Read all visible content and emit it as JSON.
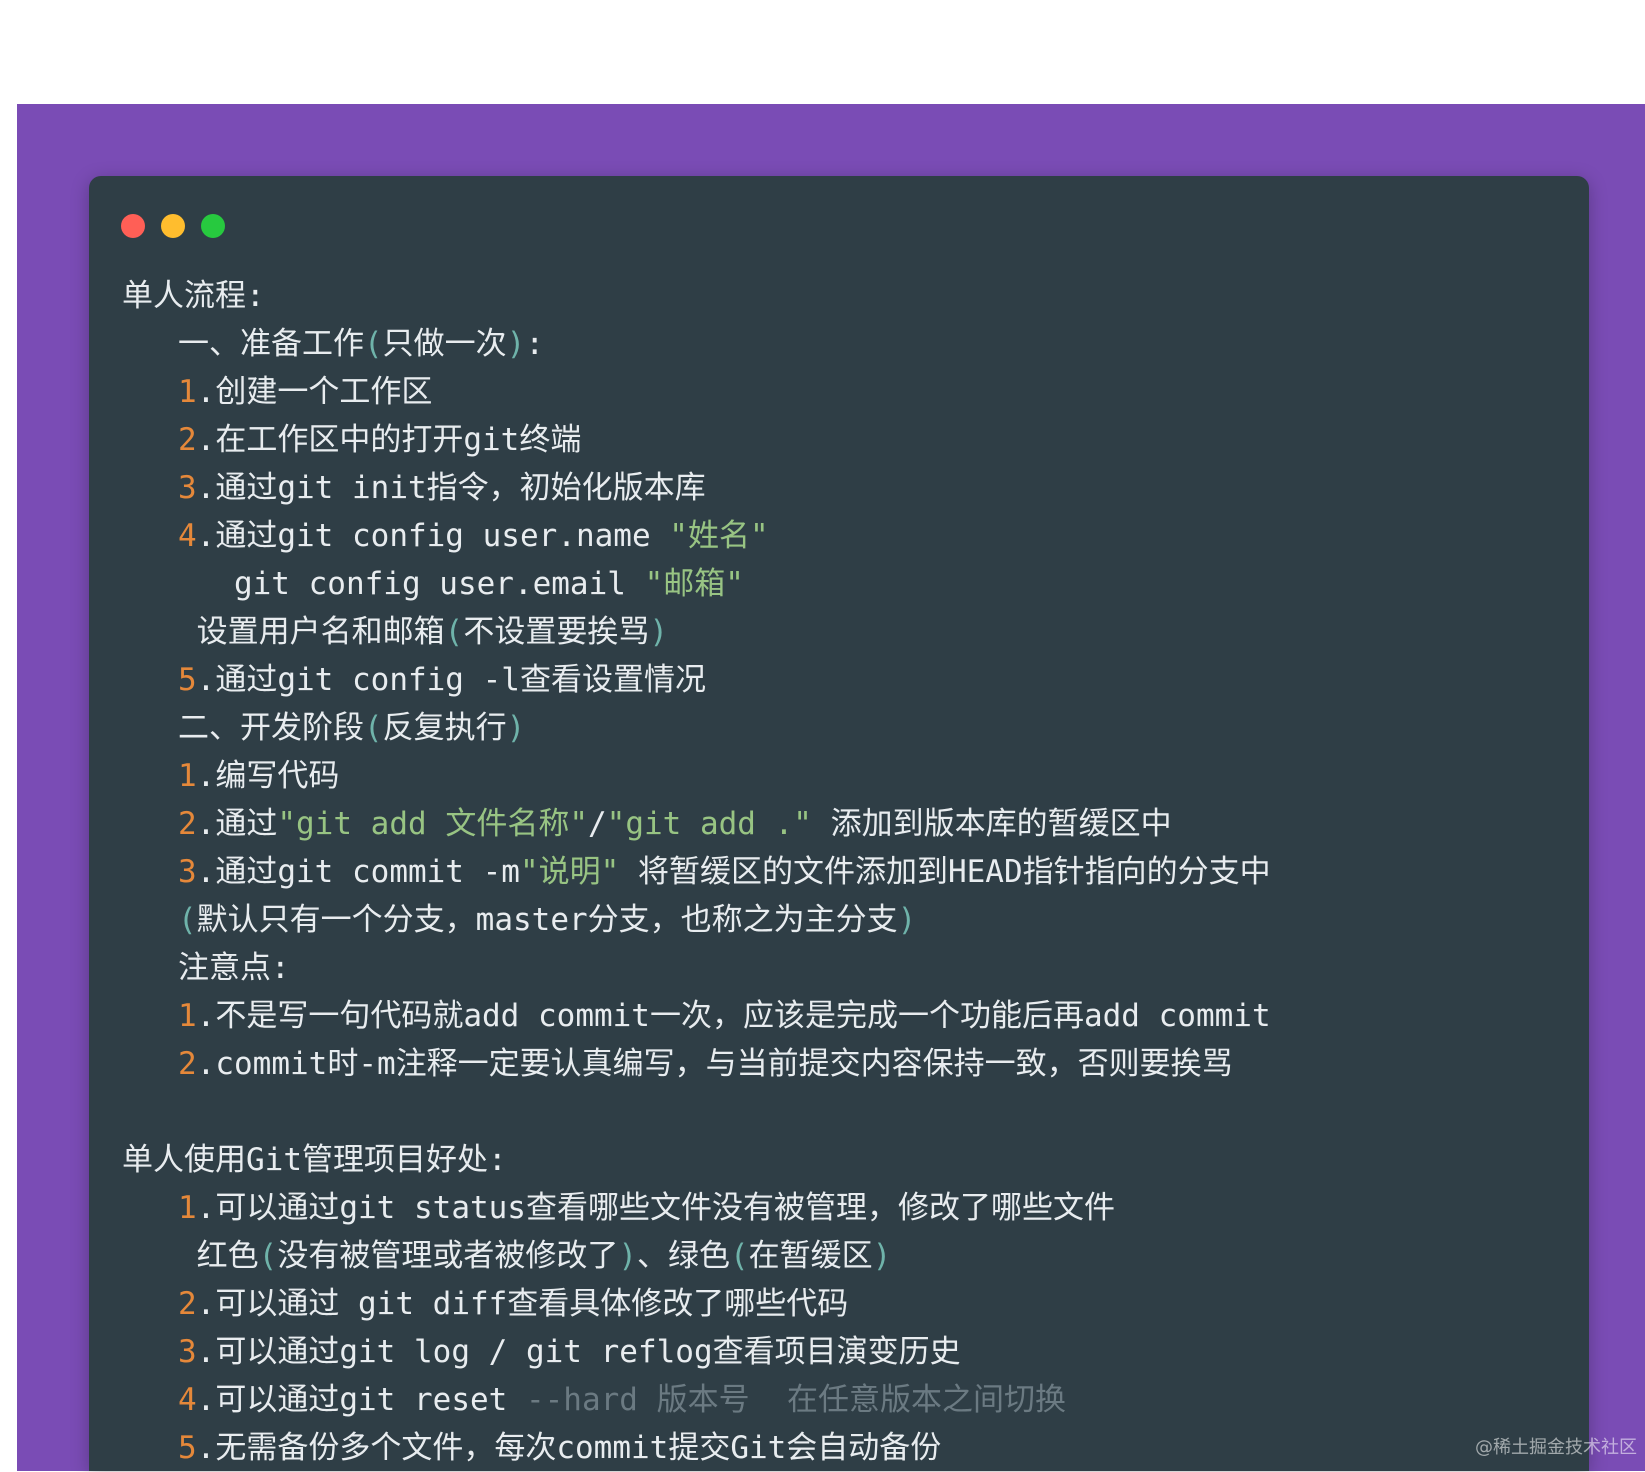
{
  "window": {
    "controls": {
      "close_color": "#ff5f56",
      "minimize_color": "#ffbd2e",
      "maximize_color": "#27c93f"
    }
  },
  "code_lines": [
    {
      "indent": "",
      "segments": [
        {
          "t": "单人流程:",
          "c": ""
        }
      ]
    },
    {
      "indent": "   ",
      "segments": [
        {
          "t": "一、准备工作",
          "c": ""
        },
        {
          "t": "(",
          "c": "paren"
        },
        {
          "t": "只做一次",
          "c": ""
        },
        {
          "t": ")",
          "c": "paren"
        },
        {
          "t": ":",
          "c": ""
        }
      ]
    },
    {
      "indent": "   ",
      "segments": [
        {
          "t": "1",
          "c": "num"
        },
        {
          "t": ".创建一个工作区",
          "c": ""
        }
      ]
    },
    {
      "indent": "   ",
      "segments": [
        {
          "t": "2",
          "c": "num"
        },
        {
          "t": ".在工作区中的打开git终端",
          "c": ""
        }
      ]
    },
    {
      "indent": "   ",
      "segments": [
        {
          "t": "3",
          "c": "num"
        },
        {
          "t": ".通过git init指令，初始化版本库",
          "c": ""
        }
      ]
    },
    {
      "indent": "   ",
      "segments": [
        {
          "t": "4",
          "c": "num"
        },
        {
          "t": ".通过git config user.name ",
          "c": ""
        },
        {
          "t": "\"姓名\"",
          "c": "str"
        }
      ]
    },
    {
      "indent": "      ",
      "segments": [
        {
          "t": "git config user.email ",
          "c": ""
        },
        {
          "t": "\"邮箱\"",
          "c": "str"
        }
      ]
    },
    {
      "indent": "    ",
      "segments": [
        {
          "t": "设置用户名和邮箱",
          "c": ""
        },
        {
          "t": "(",
          "c": "paren"
        },
        {
          "t": "不设置要挨骂",
          "c": ""
        },
        {
          "t": ")",
          "c": "paren"
        }
      ]
    },
    {
      "indent": "   ",
      "segments": [
        {
          "t": "5",
          "c": "num"
        },
        {
          "t": ".通过git config -l查看设置情况",
          "c": ""
        }
      ]
    },
    {
      "indent": "   ",
      "segments": [
        {
          "t": "二、开发阶段",
          "c": ""
        },
        {
          "t": "(",
          "c": "paren"
        },
        {
          "t": "反复执行",
          "c": ""
        },
        {
          "t": ")",
          "c": "paren"
        }
      ]
    },
    {
      "indent": "   ",
      "segments": [
        {
          "t": "1",
          "c": "num"
        },
        {
          "t": ".编写代码",
          "c": ""
        }
      ]
    },
    {
      "indent": "   ",
      "segments": [
        {
          "t": "2",
          "c": "num"
        },
        {
          "t": ".通过",
          "c": ""
        },
        {
          "t": "\"git add 文件名称\"",
          "c": "str"
        },
        {
          "t": "/",
          "c": ""
        },
        {
          "t": "\"git add .\"",
          "c": "str"
        },
        {
          "t": " 添加到版本库的暂缓区中",
          "c": ""
        }
      ]
    },
    {
      "indent": "   ",
      "segments": [
        {
          "t": "3",
          "c": "num"
        },
        {
          "t": ".通过git commit -m",
          "c": ""
        },
        {
          "t": "\"说明\"",
          "c": "str"
        },
        {
          "t": " 将暂缓区的文件添加到HEAD指针指向的分支中",
          "c": ""
        }
      ]
    },
    {
      "indent": "   ",
      "segments": [
        {
          "t": "(",
          "c": "paren"
        },
        {
          "t": "默认只有一个分支，master分支，也称之为主分支",
          "c": ""
        },
        {
          "t": ")",
          "c": "paren"
        }
      ]
    },
    {
      "indent": "   ",
      "segments": [
        {
          "t": "注意点:",
          "c": ""
        }
      ]
    },
    {
      "indent": "   ",
      "segments": [
        {
          "t": "1",
          "c": "num"
        },
        {
          "t": ".不是写一句代码就add commit一次，应该是完成一个功能后再add commit",
          "c": ""
        }
      ]
    },
    {
      "indent": "   ",
      "segments": [
        {
          "t": "2",
          "c": "num"
        },
        {
          "t": ".commit时-m注释一定要认真编写，与当前提交内容保持一致，否则要挨骂",
          "c": ""
        }
      ]
    },
    {
      "indent": "",
      "segments": []
    },
    {
      "indent": "",
      "segments": [
        {
          "t": "单人使用Git管理项目好处:",
          "c": ""
        }
      ]
    },
    {
      "indent": "   ",
      "segments": [
        {
          "t": "1",
          "c": "num"
        },
        {
          "t": ".可以通过git status查看哪些文件没有被管理，修改了哪些文件",
          "c": ""
        }
      ]
    },
    {
      "indent": "    ",
      "segments": [
        {
          "t": "红色",
          "c": ""
        },
        {
          "t": "(",
          "c": "paren"
        },
        {
          "t": "没有被管理或者被修改了",
          "c": ""
        },
        {
          "t": ")",
          "c": "paren"
        },
        {
          "t": "、绿色",
          "c": ""
        },
        {
          "t": "(",
          "c": "paren"
        },
        {
          "t": "在暂缓区",
          "c": ""
        },
        {
          "t": ")",
          "c": "paren"
        }
      ]
    },
    {
      "indent": "   ",
      "segments": [
        {
          "t": "2",
          "c": "num"
        },
        {
          "t": ".可以通过 git diff查看具体修改了哪些代码",
          "c": ""
        }
      ]
    },
    {
      "indent": "   ",
      "segments": [
        {
          "t": "3",
          "c": "num"
        },
        {
          "t": ".可以通过git log / git reflog查看项目演变历史",
          "c": ""
        }
      ]
    },
    {
      "indent": "   ",
      "segments": [
        {
          "t": "4",
          "c": "num"
        },
        {
          "t": ".可以通过git reset ",
          "c": ""
        },
        {
          "t": "--hard 版本号  在任意版本之间切换",
          "c": "dim"
        }
      ]
    },
    {
      "indent": "   ",
      "segments": [
        {
          "t": "5",
          "c": "num"
        },
        {
          "t": ".无需备份多个文件，每次commit提交Git会自动备份",
          "c": ""
        }
      ]
    }
  ],
  "watermark": "@稀土掘金技术社区"
}
